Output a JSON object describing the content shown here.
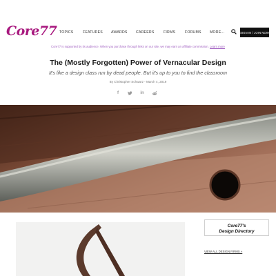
{
  "brand": {
    "logo_text": "Core77",
    "accent": "#a8187e"
  },
  "nav": {
    "items": [
      "TOPICS",
      "FEATURES",
      "AWARDS",
      "CAREERS",
      "FIRMS",
      "FORUMS",
      "MORE..."
    ],
    "search_icon": "search-icon",
    "join_label": "SIGN IN / JOIN NOW"
  },
  "affiliate": {
    "text": "Core77 is supported by its audience. When you purchase through links on our site, we may earn an affiliate commission.",
    "link": "Learn more"
  },
  "article": {
    "title": "The (Mostly Forgotten) Power of Vernacular Design",
    "subtitle": "It's like a design class run by dead people. But it's up to you to find the classroom",
    "byline": "By Christopher Schwarz - March 4, 2019"
  },
  "share": {
    "icons": [
      "facebook-icon",
      "twitter-icon",
      "linkedin-icon",
      "reddit-icon"
    ],
    "glyphs": [
      "f",
      "t",
      "in",
      "r"
    ]
  },
  "directory": {
    "line1": "Core77's",
    "line2": "Design Directory",
    "view_all": "VIEW ALL DESIGN FIRMS »"
  }
}
